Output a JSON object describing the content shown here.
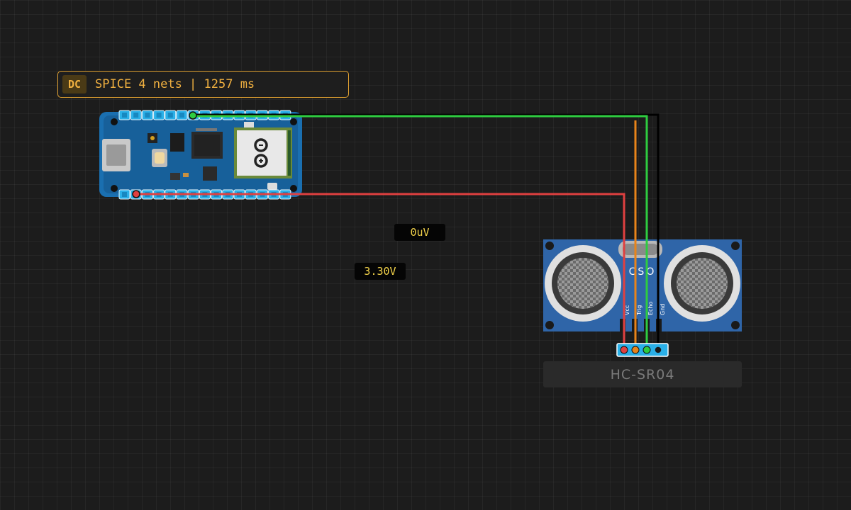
{
  "status": {
    "badge": "DC",
    "text": "SPICE 4 nets | 1257 ms"
  },
  "probes": [
    {
      "value": "0uV"
    },
    {
      "value": "3.30V"
    }
  ],
  "sensor": {
    "name": "HC-SR04",
    "pin_labels": [
      "Vcc",
      "Trig",
      "Echo",
      "Gnd"
    ],
    "silk": "CSO"
  },
  "wires": [
    {
      "net": "signal-green",
      "color": "#2ecc40"
    },
    {
      "net": "power-red",
      "color": "#e04040"
    },
    {
      "net": "trig-orange",
      "color": "#e8841a"
    },
    {
      "net": "ground-black",
      "color": "#000000"
    }
  ]
}
